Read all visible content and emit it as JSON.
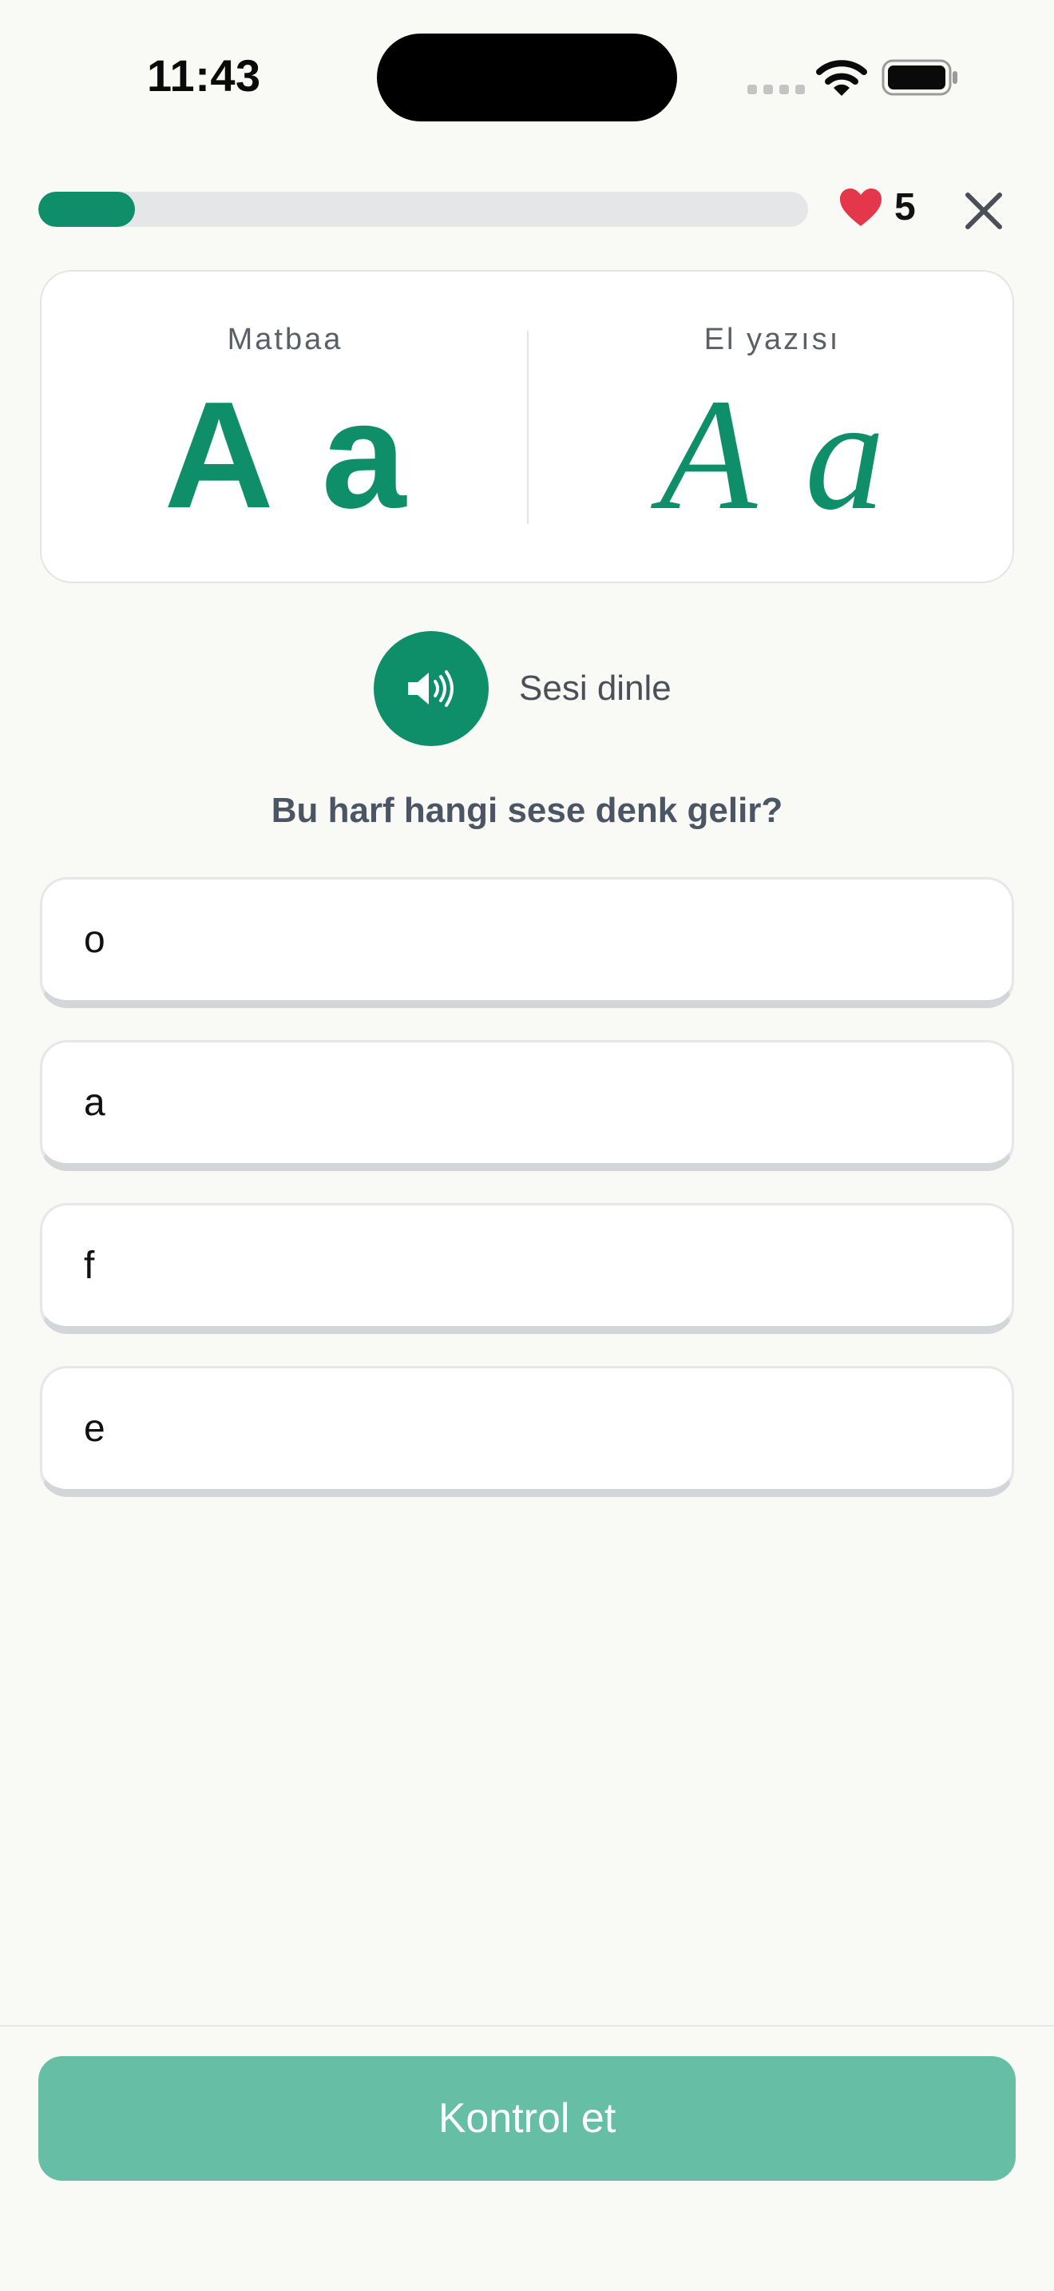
{
  "status_bar": {
    "time": "11:43"
  },
  "header": {
    "progress": 0.125,
    "hearts": "5",
    "colors": {
      "progress": "#0e8f6a",
      "heart": "#e5374b"
    }
  },
  "letter_card": {
    "print": {
      "label": "Matbaa",
      "upper": "A",
      "lower": "a"
    },
    "script": {
      "label": "El yazısı",
      "upper": "A",
      "lower": "a"
    }
  },
  "listen": {
    "label": "Sesi dinle",
    "icon": "speaker-icon"
  },
  "question": "Bu harf hangi sese denk gelir?",
  "options": [
    {
      "label": "o"
    },
    {
      "label": "a"
    },
    {
      "label": "f"
    },
    {
      "label": "e"
    }
  ],
  "footer": {
    "check_label": "Kontrol et",
    "accent": "#66bfa4"
  }
}
